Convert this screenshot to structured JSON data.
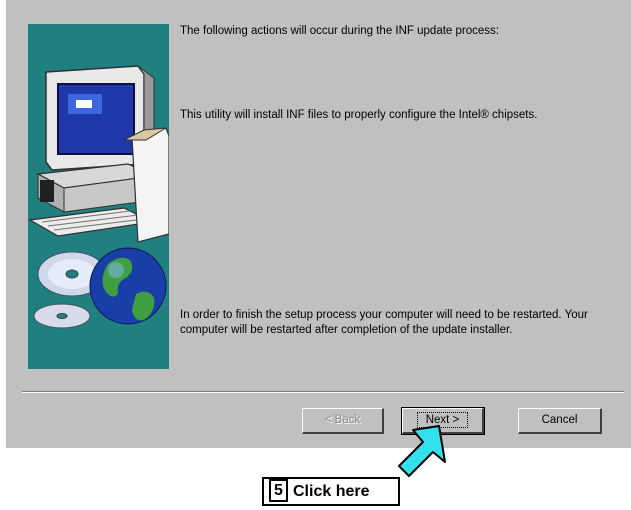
{
  "dialog": {
    "line1": "The following actions will occur during the INF update process:",
    "line2": "This utility will install INF files to properly configure the Intel® chipsets.",
    "line3": "In order to finish the setup process your computer will need to be restarted.  Your computer will be restarted after completion of the update installer."
  },
  "buttons": {
    "back": "< Back",
    "next": "Next >",
    "cancel": "Cancel"
  },
  "callout": {
    "step": "5",
    "text": "Click here"
  },
  "colors": {
    "dialog_bg": "#c0c0c0",
    "side_panel": "#208080",
    "arrow": "#33e0ee"
  },
  "icons": [
    "computer-illustration",
    "cd-disc-icon",
    "globe-icon",
    "pointer-arrow"
  ]
}
